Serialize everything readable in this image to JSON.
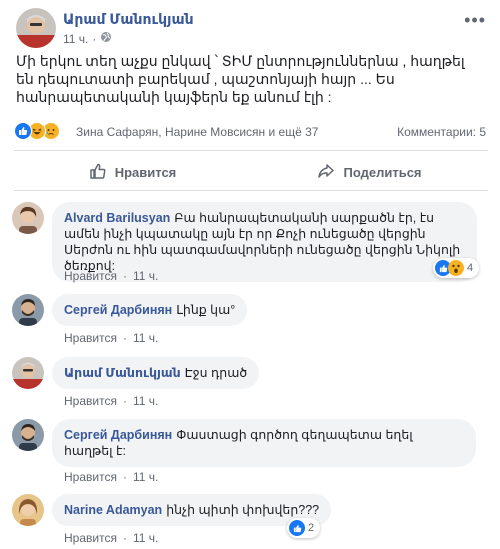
{
  "post": {
    "author": "Արամ Մանուկյան",
    "time": "11 ч.",
    "text": "Մի երկու տեղ աչքս ընկավ ՝ ՏԻՄ ընտրություններնա , հաղթել են դեպուտատի բարեկամ , պաշտոնյայի հայր ... Ես հանրապետականի կայֆերն եք անում էլի :",
    "reactors": "Зина Сафарян, Нарине Мовсисян и ещё 37",
    "comments_count": "Комментарии: 5",
    "like_label": "Нравится",
    "share_label": "Поделиться"
  },
  "comments": [
    {
      "author": "Alvard Barilusyan",
      "text": "Բա հանրապետականի սարքածն էր, էս ամեն ինչի կպատակը այն էր որ Քոչի ունեցածը վերցին Սերժոն ու հին պատգամավորների ունեցածը վերցին Նիկոլի ծեռքով:",
      "like_label": "Нравится",
      "time": "11 ч.",
      "reactions_count": "4"
    },
    {
      "author": "Сергей Дарбинян",
      "text": "Լինք կա°",
      "like_label": "Нравится",
      "time": "11 ч."
    },
    {
      "author": "Արամ Մանուկյան",
      "text": "Էջս դրած",
      "like_label": "Нравится",
      "time": "11 ч."
    },
    {
      "author": "Сергей Дарбинян",
      "text": "Փաստացի գործող գեղապետա եղել հաղթել է:",
      "like_label": "Нравится",
      "time": "11 ч."
    },
    {
      "author": "Narine Adamyan",
      "text": "ինչի պիտի փոխվեր???",
      "like_label": "Нравится",
      "time": "11 ч.",
      "reactions_count": "2"
    }
  ],
  "colors": {
    "link": "#385898",
    "secondary_text": "#616770",
    "bubble": "#f2f3f5",
    "divider": "#dadde1",
    "like_blue": "#1877f2"
  }
}
